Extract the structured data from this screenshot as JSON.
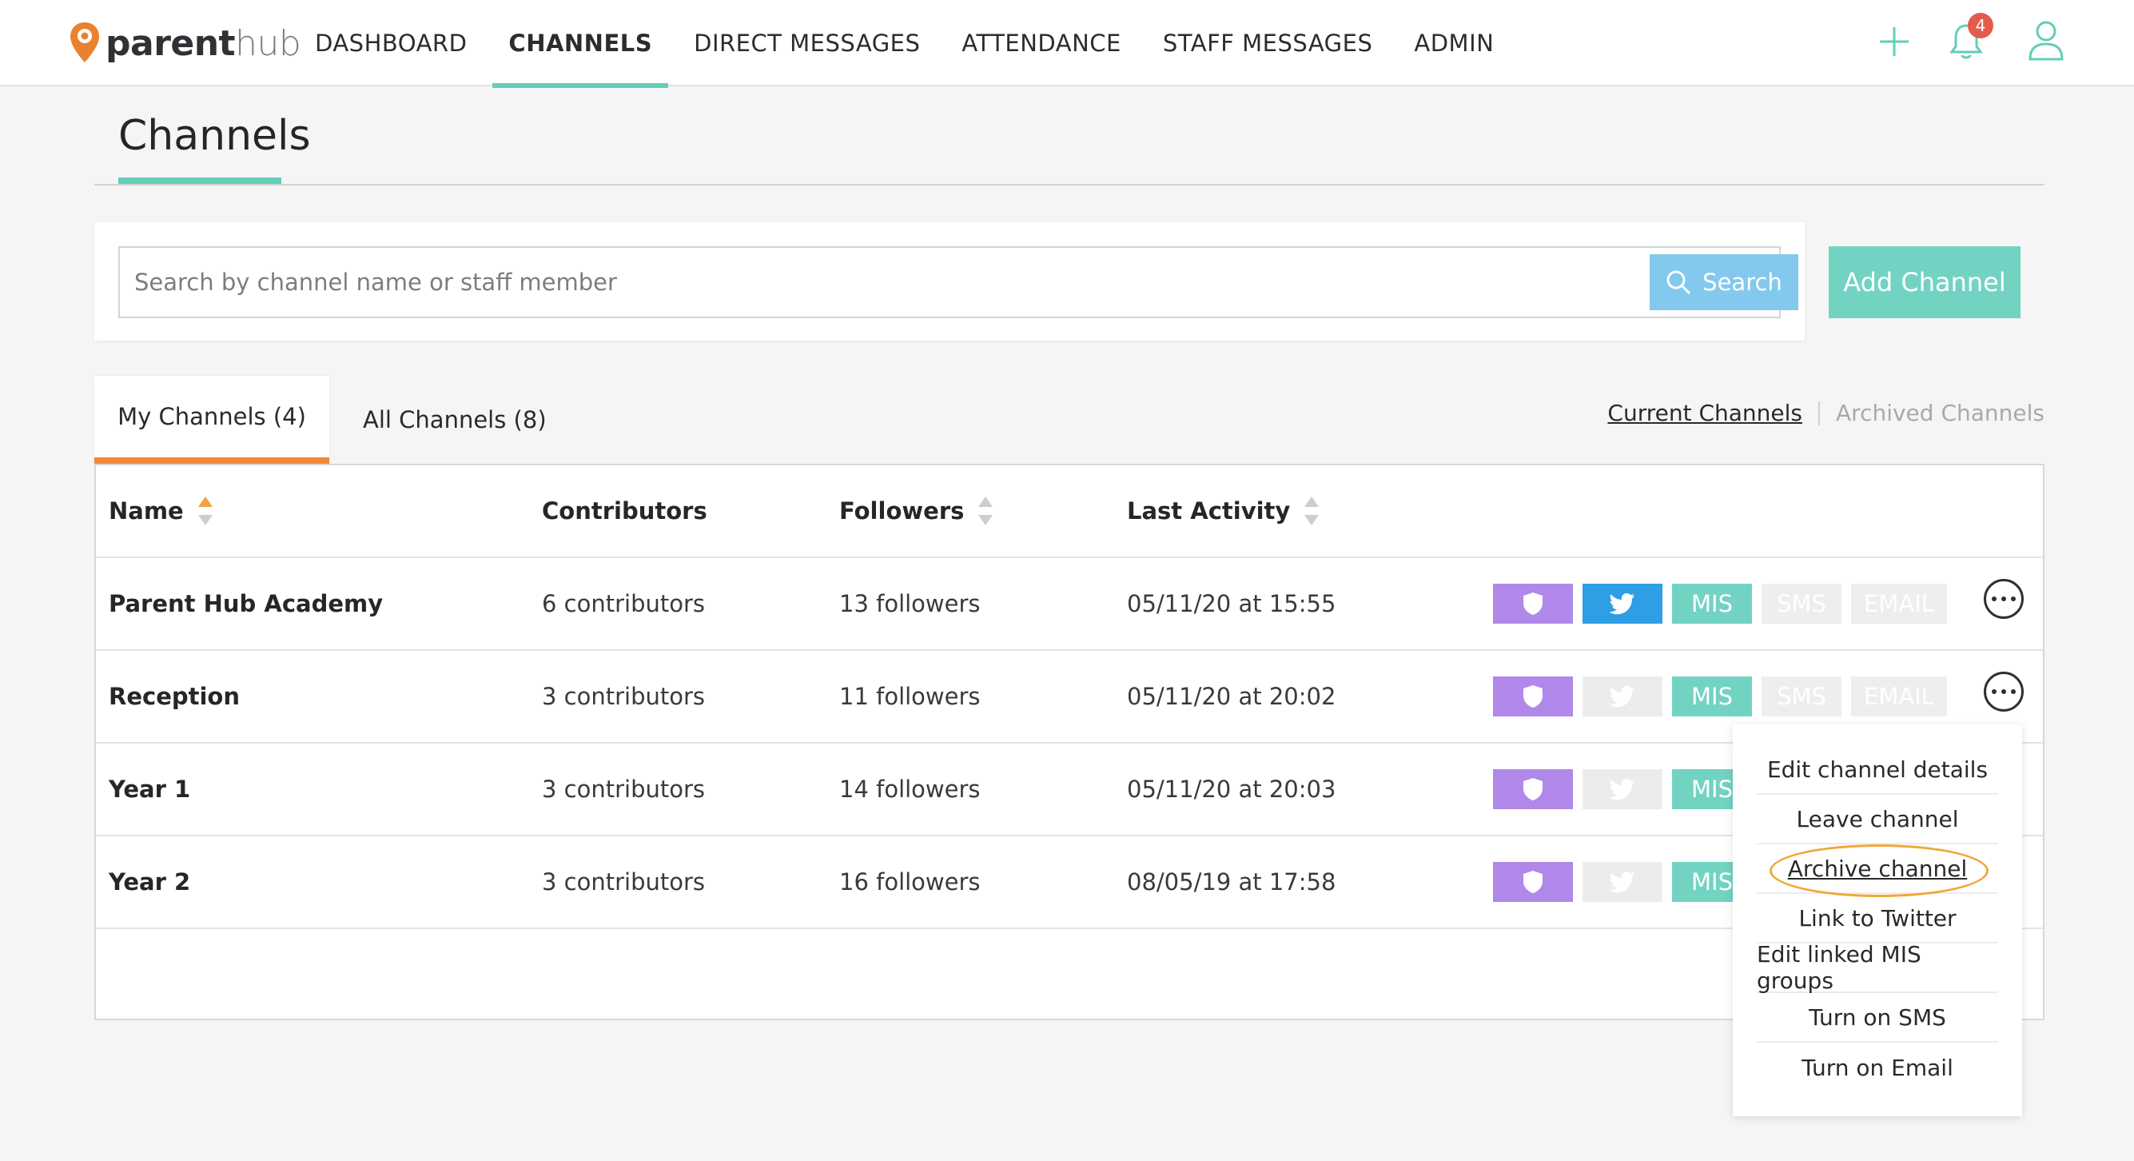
{
  "app": {
    "logo_part1": "parent",
    "logo_part2": "hub",
    "notification_count": "4",
    "colors": {
      "accent": "#63cdb9",
      "tab_accent": "#f08838",
      "badge": "#e25b4e",
      "shield": "#b088ea",
      "twitter": "#2e9ee5",
      "mis": "#72d3c3",
      "search": "#83c9ee",
      "highlight": "#f0a73a"
    },
    "icons": [
      "logo-pin-icon",
      "plus-icon",
      "bell-icon",
      "user-icon"
    ]
  },
  "nav": {
    "items": [
      {
        "label": "DASHBOARD",
        "active": false
      },
      {
        "label": "CHANNELS",
        "active": true
      },
      {
        "label": "DIRECT MESSAGES",
        "active": false
      },
      {
        "label": "ATTENDANCE",
        "active": false
      },
      {
        "label": "STAFF MESSAGES",
        "active": false
      },
      {
        "label": "ADMIN",
        "active": false
      }
    ]
  },
  "page": {
    "title": "Channels"
  },
  "search": {
    "placeholder": "Search by channel name or staff member",
    "value": "",
    "button_label": "Search",
    "add_label": "Add Channel"
  },
  "tabs": {
    "my": "My Channels (4)",
    "all": "All Channels (8)",
    "current": "Current Channels",
    "archived": "Archived Channels"
  },
  "table": {
    "headers": {
      "name": "Name",
      "contributors": "Contributors",
      "followers": "Followers",
      "last_activity": "Last Activity"
    },
    "tag_labels": {
      "mis": "MIS",
      "sms": "SMS",
      "email": "EMAIL"
    },
    "rows": [
      {
        "name": "Parent Hub Academy",
        "contributors": "6 contributors",
        "followers": "13 followers",
        "last_activity": "05/11/20 at 15:55",
        "twitter": true
      },
      {
        "name": "Reception",
        "contributors": "3 contributors",
        "followers": "11 followers",
        "last_activity": "05/11/20 at 20:02",
        "twitter": false
      },
      {
        "name": "Year 1",
        "contributors": "3 contributors",
        "followers": "14 followers",
        "last_activity": "05/11/20 at 20:03",
        "twitter": false
      },
      {
        "name": "Year 2",
        "contributors": "3 contributors",
        "followers": "16 followers",
        "last_activity": "08/05/19 at 17:58",
        "twitter": false
      }
    ]
  },
  "menu": {
    "items": [
      "Edit channel details",
      "Leave channel",
      "Archive channel",
      "Link to Twitter",
      "Edit linked MIS groups",
      "Turn on SMS",
      "Turn on Email"
    ],
    "highlighted": "Archive channel"
  }
}
